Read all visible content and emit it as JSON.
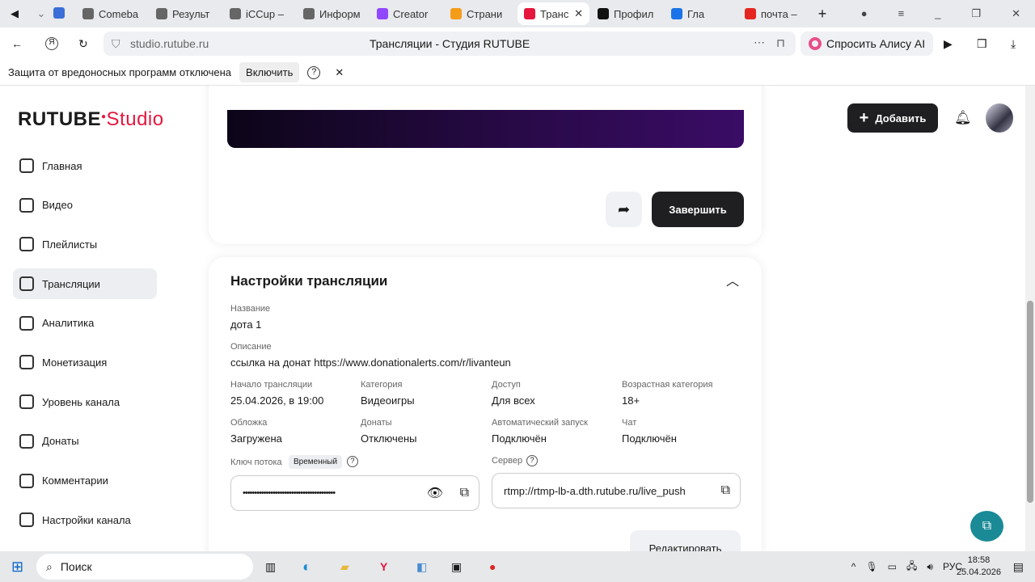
{
  "browser": {
    "tabs": [
      {
        "label": "Comeba",
        "color": "#666"
      },
      {
        "label": "Результ",
        "color": "#666"
      },
      {
        "label": "iCCup –",
        "color": "#666"
      },
      {
        "label": "Информ",
        "color": "#666"
      },
      {
        "label": "Creator",
        "color": "#9146ff"
      },
      {
        "label": "Страни",
        "color": "#f59c1a"
      },
      {
        "label": "Транс",
        "color": "#e5173f",
        "active": true
      },
      {
        "label": "Профил",
        "color": "#111"
      },
      {
        "label": "Гла",
        "color": "#1a73e8"
      },
      {
        "label": "почта –",
        "color": "#e52620"
      }
    ],
    "url": "studio.rutube.ru",
    "page_title": "Трансляции - Студия RUTUBE",
    "alice": "Спросить Алису AI",
    "infobar": {
      "text": "Защита от вредоносных программ отключена",
      "button": "Включить"
    }
  },
  "header": {
    "logo": "RUTUBE",
    "logo_suffix": "Studio",
    "add_button": "Добавить"
  },
  "sidebar": {
    "items": [
      {
        "label": "Главная"
      },
      {
        "label": "Видео"
      },
      {
        "label": "Плейлисты"
      },
      {
        "label": "Трансляции",
        "active": true
      },
      {
        "label": "Аналитика"
      },
      {
        "label": "Монетизация"
      },
      {
        "label": "Уровень канала"
      },
      {
        "label": "Донаты"
      },
      {
        "label": "Комментарии"
      },
      {
        "label": "Настройки канала"
      }
    ]
  },
  "stream": {
    "finish_button": "Завершить"
  },
  "settings": {
    "title": "Настройки трансляции",
    "name_label": "Название",
    "name": "дота 1",
    "desc_label": "Описание",
    "desc": "ссылка на донат https://www.donationalerts.com/r/livanteun",
    "start_label": "Начало трансляции",
    "start": "25.04.2026, в 19:00",
    "category_label": "Категория",
    "category": "Видеоигры",
    "access_label": "Доступ",
    "access": "Для всех",
    "age_label": "Возрастная категория",
    "age": "18+",
    "cover_label": "Обложка",
    "cover": "Загружена",
    "donates_label": "Донаты",
    "donates": "Отключены",
    "autostart_label": "Автоматический запуск",
    "autostart": "Подключён",
    "chat_label": "Чат",
    "chat": "Подключён",
    "key_label": "Ключ потока",
    "key_badge": "Временный",
    "key_value": "••••••••••••••••••••••••••••••••••••••••",
    "server_label": "Сервер",
    "server": "rtmp://rtmp-lb-a.dth.rutube.ru/live_push",
    "edit_button": "Редактировать"
  },
  "taskbar": {
    "search": "Поиск",
    "lang": "РУС",
    "time": "18:58",
    "date": "25.04.2026"
  }
}
